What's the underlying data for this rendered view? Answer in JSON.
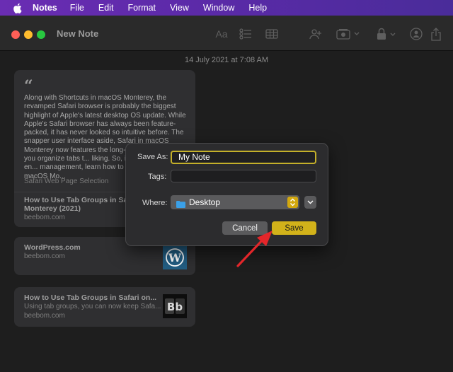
{
  "menubar": {
    "app_name": "Notes",
    "items": [
      "File",
      "Edit",
      "Format",
      "View",
      "Window",
      "Help"
    ]
  },
  "window": {
    "title": "New Note",
    "toolbar": {
      "format_label": "Aa",
      "icons": [
        "format-text-icon",
        "checklist-icon",
        "table-icon",
        "collaborate-icon",
        "media-icon",
        "lock-icon",
        "share-icon"
      ]
    }
  },
  "note": {
    "date": "14 July 2021 at 7:08 AM",
    "cards": [
      {
        "quote_mark": "“",
        "excerpt": "Along with Shortcuts in macOS Monterey, the revamped Safari browser is probably the biggest highlight of Apple's latest desktop OS update. While Apple's Safari browser has always been feature-packed, it has never looked so intuitive before. The snapper user interface aside, Safari in macOS Monterey now features the long-a... Groups\" to let you organize tabs t... liking. So, if you want to put an en... management, learn how to use tab... on macOS Mo...",
        "sub": "Safari Web Page Selection",
        "title": "How to Use Tab Groups in Safari in macOS Monterey (2021)",
        "site": "beebom.com"
      },
      {
        "title": "WordPress.com",
        "site": "beebom.com",
        "thumb": "wordpress-logo"
      },
      {
        "title": "How to Use Tab Groups in Safari on...",
        "desc": "Using tab groups, you can now keep Safa...",
        "site": "beebom.com",
        "thumb": "beebom-logo"
      }
    ]
  },
  "dialog": {
    "save_as_label": "Save As:",
    "save_as_value": "My Note",
    "tags_label": "Tags:",
    "tags_value": "",
    "where_label": "Where:",
    "where_value": "Desktop",
    "cancel_label": "Cancel",
    "save_label": "Save"
  },
  "colors": {
    "accent": "#d2b21a",
    "menubar": "#5b2aa8",
    "arrow": "#e3262a"
  }
}
